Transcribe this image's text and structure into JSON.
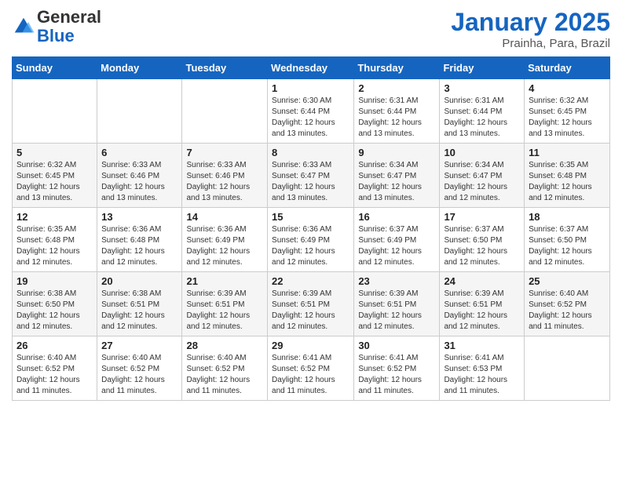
{
  "header": {
    "logo_line1": "General",
    "logo_line2": "Blue",
    "month_title": "January 2025",
    "subtitle": "Prainha, Para, Brazil"
  },
  "weekdays": [
    "Sunday",
    "Monday",
    "Tuesday",
    "Wednesday",
    "Thursday",
    "Friday",
    "Saturday"
  ],
  "weeks": [
    [
      {
        "day": "",
        "info": ""
      },
      {
        "day": "",
        "info": ""
      },
      {
        "day": "",
        "info": ""
      },
      {
        "day": "1",
        "info": "Sunrise: 6:30 AM\nSunset: 6:44 PM\nDaylight: 12 hours\nand 13 minutes."
      },
      {
        "day": "2",
        "info": "Sunrise: 6:31 AM\nSunset: 6:44 PM\nDaylight: 12 hours\nand 13 minutes."
      },
      {
        "day": "3",
        "info": "Sunrise: 6:31 AM\nSunset: 6:44 PM\nDaylight: 12 hours\nand 13 minutes."
      },
      {
        "day": "4",
        "info": "Sunrise: 6:32 AM\nSunset: 6:45 PM\nDaylight: 12 hours\nand 13 minutes."
      }
    ],
    [
      {
        "day": "5",
        "info": "Sunrise: 6:32 AM\nSunset: 6:45 PM\nDaylight: 12 hours\nand 13 minutes."
      },
      {
        "day": "6",
        "info": "Sunrise: 6:33 AM\nSunset: 6:46 PM\nDaylight: 12 hours\nand 13 minutes."
      },
      {
        "day": "7",
        "info": "Sunrise: 6:33 AM\nSunset: 6:46 PM\nDaylight: 12 hours\nand 13 minutes."
      },
      {
        "day": "8",
        "info": "Sunrise: 6:33 AM\nSunset: 6:47 PM\nDaylight: 12 hours\nand 13 minutes."
      },
      {
        "day": "9",
        "info": "Sunrise: 6:34 AM\nSunset: 6:47 PM\nDaylight: 12 hours\nand 13 minutes."
      },
      {
        "day": "10",
        "info": "Sunrise: 6:34 AM\nSunset: 6:47 PM\nDaylight: 12 hours\nand 12 minutes."
      },
      {
        "day": "11",
        "info": "Sunrise: 6:35 AM\nSunset: 6:48 PM\nDaylight: 12 hours\nand 12 minutes."
      }
    ],
    [
      {
        "day": "12",
        "info": "Sunrise: 6:35 AM\nSunset: 6:48 PM\nDaylight: 12 hours\nand 12 minutes."
      },
      {
        "day": "13",
        "info": "Sunrise: 6:36 AM\nSunset: 6:48 PM\nDaylight: 12 hours\nand 12 minutes."
      },
      {
        "day": "14",
        "info": "Sunrise: 6:36 AM\nSunset: 6:49 PM\nDaylight: 12 hours\nand 12 minutes."
      },
      {
        "day": "15",
        "info": "Sunrise: 6:36 AM\nSunset: 6:49 PM\nDaylight: 12 hours\nand 12 minutes."
      },
      {
        "day": "16",
        "info": "Sunrise: 6:37 AM\nSunset: 6:49 PM\nDaylight: 12 hours\nand 12 minutes."
      },
      {
        "day": "17",
        "info": "Sunrise: 6:37 AM\nSunset: 6:50 PM\nDaylight: 12 hours\nand 12 minutes."
      },
      {
        "day": "18",
        "info": "Sunrise: 6:37 AM\nSunset: 6:50 PM\nDaylight: 12 hours\nand 12 minutes."
      }
    ],
    [
      {
        "day": "19",
        "info": "Sunrise: 6:38 AM\nSunset: 6:50 PM\nDaylight: 12 hours\nand 12 minutes."
      },
      {
        "day": "20",
        "info": "Sunrise: 6:38 AM\nSunset: 6:51 PM\nDaylight: 12 hours\nand 12 minutes."
      },
      {
        "day": "21",
        "info": "Sunrise: 6:39 AM\nSunset: 6:51 PM\nDaylight: 12 hours\nand 12 minutes."
      },
      {
        "day": "22",
        "info": "Sunrise: 6:39 AM\nSunset: 6:51 PM\nDaylight: 12 hours\nand 12 minutes."
      },
      {
        "day": "23",
        "info": "Sunrise: 6:39 AM\nSunset: 6:51 PM\nDaylight: 12 hours\nand 12 minutes."
      },
      {
        "day": "24",
        "info": "Sunrise: 6:39 AM\nSunset: 6:51 PM\nDaylight: 12 hours\nand 12 minutes."
      },
      {
        "day": "25",
        "info": "Sunrise: 6:40 AM\nSunset: 6:52 PM\nDaylight: 12 hours\nand 11 minutes."
      }
    ],
    [
      {
        "day": "26",
        "info": "Sunrise: 6:40 AM\nSunset: 6:52 PM\nDaylight: 12 hours\nand 11 minutes."
      },
      {
        "day": "27",
        "info": "Sunrise: 6:40 AM\nSunset: 6:52 PM\nDaylight: 12 hours\nand 11 minutes."
      },
      {
        "day": "28",
        "info": "Sunrise: 6:40 AM\nSunset: 6:52 PM\nDaylight: 12 hours\nand 11 minutes."
      },
      {
        "day": "29",
        "info": "Sunrise: 6:41 AM\nSunset: 6:52 PM\nDaylight: 12 hours\nand 11 minutes."
      },
      {
        "day": "30",
        "info": "Sunrise: 6:41 AM\nSunset: 6:52 PM\nDaylight: 12 hours\nand 11 minutes."
      },
      {
        "day": "31",
        "info": "Sunrise: 6:41 AM\nSunset: 6:53 PM\nDaylight: 12 hours\nand 11 minutes."
      },
      {
        "day": "",
        "info": ""
      }
    ]
  ]
}
